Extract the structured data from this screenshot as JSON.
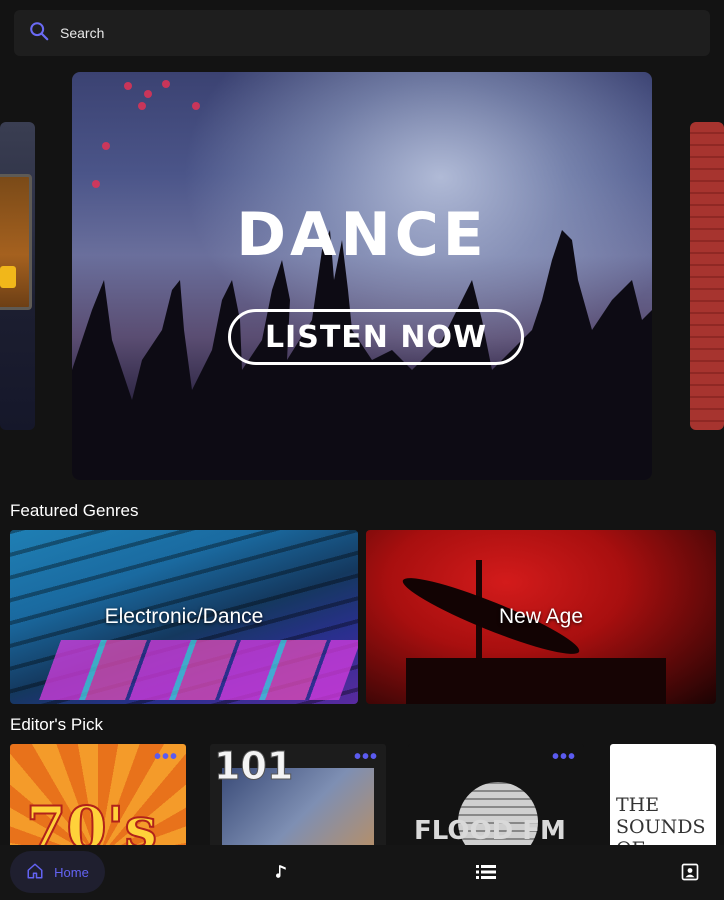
{
  "search": {
    "placeholder": "Search"
  },
  "hero": {
    "title": "DANCE",
    "button_label": "LISTEN NOW"
  },
  "featured_genres": {
    "title": "Featured Genres",
    "items": [
      {
        "label": "Electronic/Dance"
      },
      {
        "label": "New Age"
      }
    ]
  },
  "editors_pick": {
    "title": "Editor's Pick",
    "more_label": "•••",
    "items": [
      {
        "art_text": "70's"
      },
      {
        "art_text": "101"
      },
      {
        "art_text": "FLOOD FM"
      },
      {
        "art_text": "THE SOUNDS OF BRAZIL"
      }
    ]
  },
  "bottom_nav": {
    "items": [
      {
        "label": "Home",
        "icon": "home-icon",
        "active": true
      },
      {
        "label": "",
        "icon": "music-note-icon"
      },
      {
        "label": "",
        "icon": "list-icon"
      },
      {
        "label": "",
        "icon": "profile-icon"
      }
    ]
  },
  "colors": {
    "accent": "#5b5bf0",
    "background": "#131313",
    "surface": "#1e1e1e"
  }
}
